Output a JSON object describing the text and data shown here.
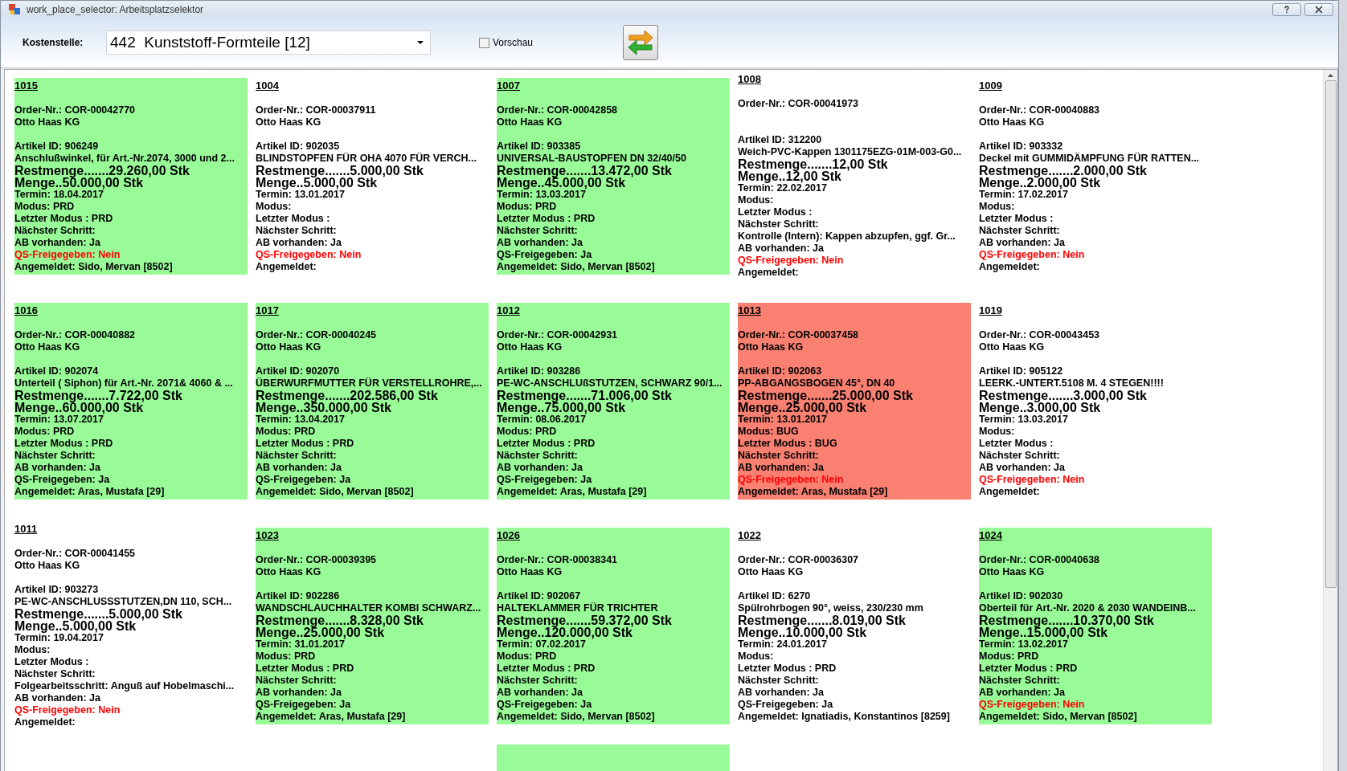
{
  "window": {
    "title": "work_place_selector: Arbeitsplatzselektor"
  },
  "toolbar": {
    "cost_center_label": "Kostenstelle:",
    "cost_center_value": "442  Kunststoff-Formteile [12]",
    "preview": {
      "label": "Vorschau",
      "checked": false
    }
  },
  "cards": [
    {
      "color": "#98fb98",
      "number": "1015",
      "order": "Order-Nr.: COR-00042770",
      "customer": "Otto Haas KG",
      "article_id": "Artikel ID: 906249",
      "description": "Anschlußwinkel, für Art.-Nr.2074, 3000 und 2...",
      "remaining": "Restmenge.......29.260,00 Stk",
      "quantity": "Menge..50.000,00 Stk",
      "due": "Termin: 18.04.2017",
      "mode": "Modus: PRD",
      "last_mode": "Letzter Modus : PRD",
      "next_step": "Nächster Schritt:",
      "confirmation": "AB vorhanden: Ja",
      "qs": {
        "text": "QS-Freigegeben: Nein",
        "released": false
      },
      "registered": "Angemeldet: Sido, Mervan [8502]"
    },
    {
      "color": "#ffffff",
      "number": "1004",
      "order": "Order-Nr.: COR-00037911",
      "customer": "Otto Haas KG",
      "article_id": "Artikel ID: 902035",
      "description": "BLINDSTOPFEN FÜR OHA 4070 FÜR VERCH...",
      "remaining": "Restmenge.......5.000,00 Stk",
      "quantity": "Menge..5.000,00 Stk",
      "due": "Termin: 13.01.2017",
      "mode": "Modus:",
      "last_mode": "Letzter Modus :",
      "next_step": "Nächster Schritt:",
      "confirmation": "AB vorhanden: Ja",
      "qs": {
        "text": "QS-Freigegeben: Nein",
        "released": false
      },
      "registered": "Angemeldet:"
    },
    {
      "color": "#98fb98",
      "number": "1007",
      "order": "Order-Nr.: COR-00042858",
      "customer": "Otto Haas KG",
      "article_id": "Artikel ID: 903385",
      "description": "UNIVERSAL-BAUSTOPFEN DN 32/40/50",
      "remaining": "Restmenge.......13.472,00 Stk",
      "quantity": "Menge..45.000,00 Stk",
      "due": "Termin: 13.03.2017",
      "mode": "Modus: PRD",
      "last_mode": "Letzter Modus : PRD",
      "next_step": "Nächster Schritt:",
      "confirmation": "AB vorhanden: Ja",
      "qs": {
        "text": "QS-Freigegeben: Ja",
        "released": true
      },
      "registered": "Angemeldet: Sido, Mervan [8502]"
    },
    {
      "color": "#ffffff",
      "number": "1008",
      "order": "Order-Nr.: COR-00041973",
      "article_id": "Artikel ID: 312200",
      "description": "Weich-PVC-Kappen 1301175EZG-01M-003-G0...",
      "remaining": "Restmenge.......12,00 Stk",
      "quantity": "Menge..12,00 Stk",
      "due": "Termin: 22.02.2017",
      "mode": "Modus:",
      "last_mode": "Letzter Modus :",
      "next_step": "Nächster Schritt:",
      "follow_up": "Kontrolle (Intern): Kappen abzupfen, ggf. Gr...",
      "confirmation": "AB vorhanden: Ja",
      "qs": {
        "text": "QS-Freigegeben: Nein",
        "released": false
      },
      "registered": "Angemeldet:"
    },
    {
      "color": "#ffffff",
      "number": "1009",
      "order": "Order-Nr.: COR-00040883",
      "customer": "Otto Haas KG",
      "article_id": "Artikel ID: 903332",
      "description": "Deckel mit GUMMIDÄMPFUNG FÜR RATTEN...",
      "remaining": "Restmenge.......2.000,00 Stk",
      "quantity": "Menge..2.000,00 Stk",
      "due": "Termin: 17.02.2017",
      "mode": "Modus:",
      "last_mode": "Letzter Modus :",
      "next_step": "Nächster Schritt:",
      "confirmation": "AB vorhanden: Ja",
      "qs": {
        "text": "QS-Freigegeben: Nein",
        "released": false
      },
      "registered": "Angemeldet:"
    },
    {
      "color": "#98fb98",
      "number": "1016",
      "order": "Order-Nr.: COR-00040882",
      "customer": "Otto Haas KG",
      "article_id": "Artikel ID: 902074",
      "description": "Unterteil ( Siphon) für Art.-Nr. 2071& 4060 & ...",
      "remaining": "Restmenge.......7.722,00 Stk",
      "quantity": "Menge..60.000,00 Stk",
      "due": "Termin: 13.07.2017",
      "mode": "Modus: PRD",
      "last_mode": "Letzter Modus : PRD",
      "next_step": "Nächster Schritt:",
      "confirmation": "AB vorhanden: Ja",
      "qs": {
        "text": "QS-Freigegeben: Ja",
        "released": true
      },
      "registered": "Angemeldet: Aras, Mustafa [29]"
    },
    {
      "color": "#98fb98",
      "number": "1017",
      "order": "Order-Nr.: COR-00040245",
      "customer": "Otto Haas KG",
      "article_id": "Artikel ID: 902070",
      "description": "ÜBERWURFMUTTER FÜR VERSTELLROHRE,...",
      "remaining": "Restmenge.......202.586,00 Stk",
      "quantity": "Menge..350.000,00 Stk",
      "due": "Termin: 13.04.2017",
      "mode": "Modus: PRD",
      "last_mode": "Letzter Modus : PRD",
      "next_step": "Nächster Schritt:",
      "confirmation": "AB vorhanden: Ja",
      "qs": {
        "text": "QS-Freigegeben: Ja",
        "released": true
      },
      "registered": "Angemeldet: Sido, Mervan [8502]"
    },
    {
      "color": "#98fb98",
      "number": "1012",
      "order": "Order-Nr.: COR-00042931",
      "customer": "Otto Haas KG",
      "article_id": "Artikel ID: 903286",
      "description": "PE-WC-ANSCHLUßSTUTZEN, SCHWARZ 90/1...",
      "remaining": "Restmenge.......71.006,00 Stk",
      "quantity": "Menge..75.000,00 Stk",
      "due": "Termin: 08.06.2017",
      "mode": "Modus: PRD",
      "last_mode": "Letzter Modus : PRD",
      "next_step": "Nächster Schritt:",
      "confirmation": "AB vorhanden: Ja",
      "qs": {
        "text": "QS-Freigegeben: Ja",
        "released": true
      },
      "registered": "Angemeldet: Aras, Mustafa [29]"
    },
    {
      "color": "#fa8072",
      "number": "1013",
      "order": "Order-Nr.: COR-00037458",
      "customer": "Otto Haas KG",
      "article_id": "Artikel ID: 902063",
      "description": "PP-ABGANGSBOGEN 45°, DN 40",
      "remaining": "Restmenge.......25.000,00 Stk",
      "quantity": "Menge..25.000,00 Stk",
      "due": "Termin: 13.01.2017",
      "mode": "Modus: BUG",
      "last_mode": "Letzter Modus : BUG",
      "next_step": "Nächster Schritt:",
      "confirmation": "AB vorhanden: Ja",
      "qs": {
        "text": "QS-Freigegeben: Nein",
        "released": false
      },
      "registered": "Angemeldet: Aras, Mustafa [29]"
    },
    {
      "color": "#ffffff",
      "number": "1019",
      "order": "Order-Nr.: COR-00043453",
      "customer": "Otto Haas KG",
      "article_id": "Artikel ID: 905122",
      "description": "LEERK.-UNTERT.5108 M. 4 STEGEN!!!!",
      "remaining": "Restmenge.......3.000,00 Stk",
      "quantity": "Menge..3.000,00 Stk",
      "due": "Termin: 13.03.2017",
      "mode": "Modus:",
      "last_mode": "Letzter Modus :",
      "next_step": "Nächster Schritt:",
      "confirmation": "AB vorhanden: Ja",
      "qs": {
        "text": "QS-Freigegeben: Nein",
        "released": false
      },
      "registered": "Angemeldet:"
    },
    {
      "color": "#ffffff",
      "number": "1011",
      "order": "Order-Nr.: COR-00041455",
      "customer": "Otto Haas KG",
      "article_id": "Artikel ID: 903273",
      "description": "PE-WC-ANSCHLUSSSTUTZEN,DN 110, SCH...",
      "remaining": "Restmenge.......5.000,00 Stk",
      "quantity": "Menge..5.000,00 Stk",
      "due": "Termin: 19.04.2017",
      "mode": "Modus:",
      "last_mode": "Letzter Modus :",
      "next_step": "Nächster Schritt:",
      "follow_up": "Folgearbeitsschritt: Anguß auf Hobelmaschi...",
      "confirmation": "AB vorhanden: Ja",
      "qs": {
        "text": "QS-Freigegeben: Nein",
        "released": false
      },
      "registered": "Angemeldet:"
    },
    {
      "color": "#98fb98",
      "number": "1023",
      "order": "Order-Nr.: COR-00039395",
      "customer": "Otto Haas KG",
      "article_id": "Artikel ID: 902286",
      "description": "WANDSCHLAUCHHALTER KOMBI SCHWARZ...",
      "remaining": "Restmenge.......8.328,00 Stk",
      "quantity": "Menge..25.000,00 Stk",
      "due": "Termin: 31.01.2017",
      "mode": "Modus: PRD",
      "last_mode": "Letzter Modus : PRD",
      "next_step": "Nächster Schritt:",
      "confirmation": "AB vorhanden: Ja",
      "qs": {
        "text": "QS-Freigegeben: Ja",
        "released": true
      },
      "registered": "Angemeldet: Aras, Mustafa [29]"
    },
    {
      "color": "#98fb98",
      "number": "1026",
      "order": "Order-Nr.: COR-00038341",
      "customer": "Otto Haas KG",
      "article_id": "Artikel ID: 902067",
      "description": "HALTEKLAMMER FÜR TRICHTER",
      "remaining": "Restmenge.......59.372,00 Stk",
      "quantity": "Menge..120.000,00 Stk",
      "due": "Termin: 07.02.2017",
      "mode": "Modus: PRD",
      "last_mode": "Letzter Modus : PRD",
      "next_step": "Nächster Schritt:",
      "confirmation": "AB vorhanden: Ja",
      "qs": {
        "text": "QS-Freigegeben: Ja",
        "released": true
      },
      "registered": "Angemeldet: Sido, Mervan [8502]"
    },
    {
      "color": "#ffffff",
      "number": "1022",
      "order": "Order-Nr.: COR-00036307",
      "customer": "Otto Haas KG",
      "article_id": "Artikel ID: 6270",
      "description": "Spülrohrbogen 90°, weiss, 230/230 mm",
      "remaining": "Restmenge.......8.019,00 Stk",
      "quantity": "Menge..10.000,00 Stk",
      "due": "Termin: 24.01.2017",
      "mode": "Modus:",
      "last_mode": "Letzter Modus : PRD",
      "next_step": "Nächster Schritt:",
      "confirmation": "AB vorhanden: Ja",
      "qs": {
        "text": "QS-Freigegeben: Ja",
        "released": true
      },
      "registered": "Angemeldet: Ignatiadis, Konstantinos [8259]"
    },
    {
      "color": "#98fb98",
      "number": "1024",
      "order": "Order-Nr.: COR-00040638",
      "customer": "Otto Haas KG",
      "article_id": "Artikel ID: 902030",
      "description": "Oberteil  für Art.-Nr. 2020 & 2030 WANDEINB...",
      "remaining": "Restmenge.......10.370,00 Stk",
      "quantity": "Menge..15.000,00 Stk",
      "due": "Termin: 13.02.2017",
      "mode": "Modus: PRD",
      "last_mode": "Letzter Modus : PRD",
      "next_step": "Nächster Schritt:",
      "confirmation": "AB vorhanden: Ja",
      "qs": {
        "text": "QS-Freigegeben: Nein",
        "released": false
      },
      "registered": "Angemeldet: Sido, Mervan [8502]"
    }
  ],
  "cut_off_card": {
    "color": "#98fb98"
  }
}
